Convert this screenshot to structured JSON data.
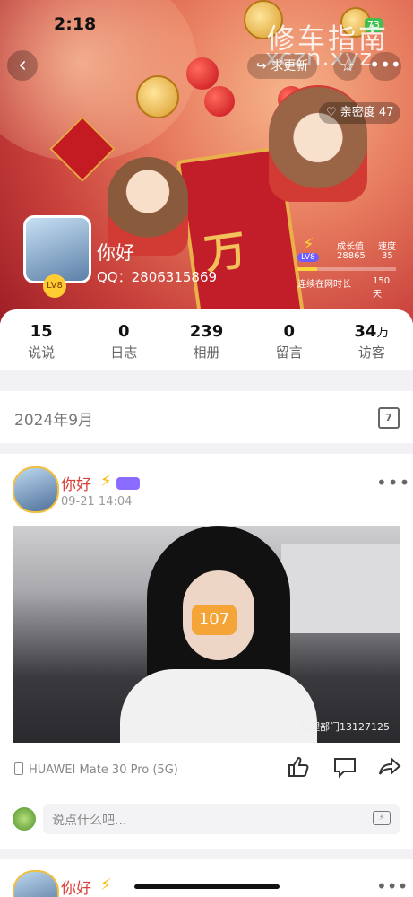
{
  "status_bar": {
    "time": "2:18",
    "battery": "73"
  },
  "watermark": {
    "line1": "修车指南",
    "line2": "xczn.xyz"
  },
  "header": {
    "back_icon": "chevron-left-icon",
    "update_label": "求更新",
    "intimacy_label": "亲密度 47",
    "nickname": "你好",
    "qq": "QQ：2806315869",
    "level": {
      "vip_label": "LV8",
      "growth_label": "成长值",
      "growth_value": "28865",
      "speed_label": "速度",
      "speed_value": "35",
      "online_label": "连续在网时长",
      "online_value": "150天"
    },
    "avatar_badge": "LV8"
  },
  "stats": [
    {
      "num": "15",
      "unit": "",
      "label": "说说"
    },
    {
      "num": "0",
      "unit": "",
      "label": "日志"
    },
    {
      "num": "239",
      "unit": "",
      "label": "相册"
    },
    {
      "num": "0",
      "unit": "",
      "label": "留言"
    },
    {
      "num": "34",
      "unit": "万",
      "label": "访客"
    }
  ],
  "date_bar": {
    "text": "2024年9月",
    "calendar_num": "7"
  },
  "post": {
    "name": "你好",
    "time": "09-21 14:04",
    "photo_badge": "107",
    "photo_watermark": "管理部门13127125",
    "device": "HUAWEI Mate 30 Pro (5G)",
    "comment_placeholder": "说点什么吧..."
  },
  "post2": {
    "name": "你好"
  }
}
